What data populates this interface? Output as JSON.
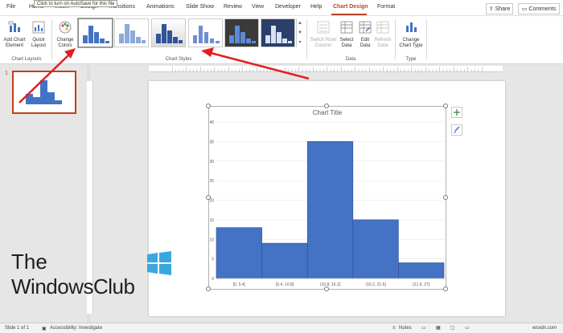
{
  "tabs": {
    "items": [
      "File",
      "Home",
      "Insert",
      "Design",
      "Transitions",
      "Animations",
      "Slide Show",
      "Review",
      "View",
      "Developer",
      "Help",
      "Chart Design",
      "Format"
    ],
    "active": "Chart Design",
    "share_label": "Share",
    "comments_label": "Comments",
    "autosave_tooltip": "Click to turn on AutoSave for this file"
  },
  "ribbon": {
    "add_chart_element": "Add Chart Element",
    "quick_layout": "Quick Layout",
    "chart_layouts_group": "Chart Layouts",
    "change_colors": "Change Colors",
    "chart_styles_group": "Chart Styles",
    "switch_row_column": "Switch Row/ Column",
    "select_data": "Select Data",
    "edit_data": "Edit Data",
    "refresh_data": "Refresh Data",
    "data_group": "Data",
    "change_chart_type": "Change Chart Type",
    "type_group": "Type"
  },
  "slides": {
    "number": "1"
  },
  "chart_data": {
    "type": "bar",
    "title": "Chart Title",
    "categories": [
      "[0, 5.4]",
      "(5.4, 10.8]",
      "(10.8, 16.2]",
      "(16.2, 21.6]",
      "(21.6, 27]"
    ],
    "values": [
      13,
      9,
      35,
      15,
      4
    ],
    "yticks": [
      "0",
      "5",
      "10",
      "15",
      "20",
      "25",
      "30",
      "35",
      "40"
    ],
    "ylim": [
      0,
      40
    ],
    "bar_color": "#4472c4",
    "grid": true
  },
  "status": {
    "slide_info": "Slide 1 of 1",
    "accessibility": "Accessibility: Investigate",
    "notes_label": "Notes",
    "site": "wsxdn.com"
  },
  "watermark": {
    "line1": "The",
    "line2": "WindowsClub"
  },
  "colors": {
    "accent": "#b7472a",
    "arrow": "#e02020"
  }
}
